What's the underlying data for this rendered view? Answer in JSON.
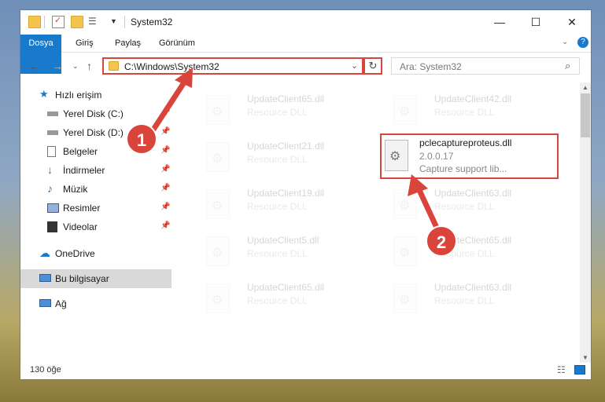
{
  "window": {
    "title": "System32",
    "controls": {
      "minimize": "—",
      "maximize": "☐",
      "close": "✕"
    }
  },
  "ribbon": {
    "tabs": [
      "Dosya",
      "Giriş",
      "Paylaş",
      "Görünüm"
    ],
    "help": "?"
  },
  "address": {
    "path": "C:\\Windows\\System32",
    "search_placeholder": "Ara: System32"
  },
  "nav": {
    "quick_access": "Hızlı erişim",
    "items": [
      {
        "label": "Yerel Disk (C:)",
        "icon": "drive-icon",
        "pinned": true
      },
      {
        "label": "Yerel Disk (D:)",
        "icon": "drive-icon",
        "pinned": true
      },
      {
        "label": "Belgeler",
        "icon": "documents-icon",
        "pinned": true
      },
      {
        "label": "İndirmeler",
        "icon": "downloads-icon",
        "pinned": true
      },
      {
        "label": "Müzik",
        "icon": "music-icon",
        "pinned": true
      },
      {
        "label": "Resimler",
        "icon": "pictures-icon",
        "pinned": true
      },
      {
        "label": "Videolar",
        "icon": "videos-icon",
        "pinned": true
      }
    ],
    "onedrive": "OneDrive",
    "this_pc": "Bu bilgisayar",
    "network": "Ağ"
  },
  "files": {
    "left_column": [
      {
        "name": "UpdateClient65.dll",
        "desc": "Resource DLL"
      },
      {
        "name": "UpdateClient21.dll",
        "desc": "Resource DLL"
      },
      {
        "name": "UpdateClient19.dll",
        "desc": "Resource DLL"
      },
      {
        "name": "UpdateClient5.dll",
        "desc": "Resource DLL"
      },
      {
        "name": "UpdateClient65.dll",
        "desc": "Resource DLL"
      }
    ],
    "right_column": [
      {
        "name": "UpdateClient42.dll",
        "desc": "Resource DLL"
      },
      {
        "name": "UpdateClient63.dll",
        "desc": "Resource DLL"
      },
      {
        "name": "UpdateClient65.dll",
        "desc": "Resource DLL"
      },
      {
        "name": "UpdateClient63.dll",
        "desc": "Resource DLL"
      }
    ],
    "highlighted": {
      "name": "pclecaptureproteus.dll",
      "version": "2.0.0.17",
      "desc": "Capture support lib..."
    }
  },
  "status": {
    "count": "130 öğe"
  },
  "annotations": {
    "step1": "1",
    "step2": "2"
  },
  "colors": {
    "accent": "#1979ca",
    "highlight": "#d9443b"
  }
}
